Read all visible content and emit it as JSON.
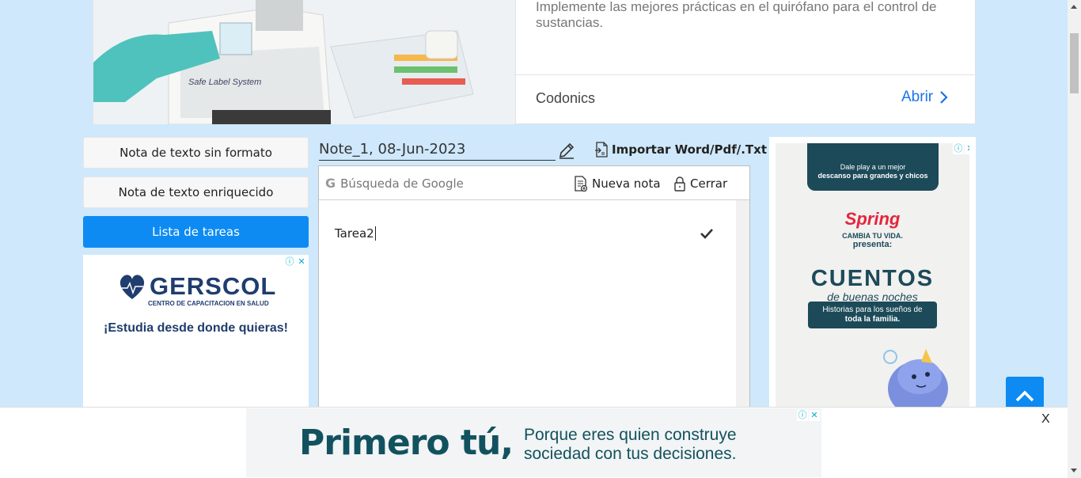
{
  "top_ad": {
    "description": "Implemente las mejores prácticas en el quirófano para el control de sustancias.",
    "brand": "Codonics",
    "open_label": "Abrir",
    "image_text": "Safe Label System"
  },
  "menu": {
    "items": [
      {
        "label": "Nota de texto sin formato"
      },
      {
        "label": "Nota de texto enriquecido"
      },
      {
        "label": "Lista de tareas"
      }
    ]
  },
  "left_ad": {
    "brand": "GERSCOL",
    "subtitle": "CENTRO DE CAPACITACION EN SALUD",
    "tagline": "¡Estudia desde donde quieras!"
  },
  "note": {
    "title": "Note_1, 08-Jun-2023",
    "import_label": "Importar Word/Pdf/.Txt",
    "search_placeholder": "Búsqueda de Google",
    "new_note_label": "Nueva nota",
    "close_label": "Cerrar",
    "tasks": [
      {
        "text": "Tarea2"
      }
    ]
  },
  "right_ad": {
    "top_line1": "Dale play a un mejor",
    "top_line2": "descanso para grandes y chicos",
    "brand": "Spring",
    "brand_sub1": "CAMBIA TU VIDA.",
    "brand_sub2": "presenta:",
    "headline": "CUENTOS",
    "headline_sub": "de buenas noches",
    "box_line1": "Historias para los sueños de",
    "box_line2": "toda la familia."
  },
  "bottom_ad": {
    "headline": "Primero tú,",
    "line1": "Porque eres quien construye",
    "line2": "sociedad con tus decisiones.",
    "close_label": "X"
  },
  "colors": {
    "page_bg": "#cfe8fb",
    "accent": "#0d8bf2",
    "link": "#1a73e8",
    "ad_teal": "#1c4a59",
    "spring_red": "#e4253c"
  }
}
